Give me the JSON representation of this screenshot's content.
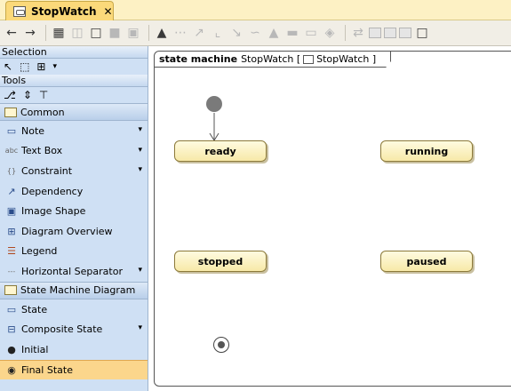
{
  "tab": {
    "title": "StopWatch",
    "close": "✕"
  },
  "palette": {
    "selection_header": "Selection",
    "tools_header": "Tools",
    "groups": [
      {
        "title": "Common",
        "items": [
          {
            "label": "Note",
            "icon": "▭",
            "caret": true
          },
          {
            "label": "Text Box",
            "icon": "abc",
            "caret": true
          },
          {
            "label": "Constraint",
            "icon": "{}",
            "caret": true
          },
          {
            "label": "Dependency",
            "icon": "↗",
            "caret": false
          },
          {
            "label": "Image Shape",
            "icon": "▣",
            "caret": false
          },
          {
            "label": "Diagram Overview",
            "icon": "⊞",
            "caret": false
          },
          {
            "label": "Legend",
            "icon": "☰",
            "caret": false
          },
          {
            "label": "Horizontal Separator",
            "icon": "---",
            "caret": true
          }
        ]
      },
      {
        "title": "State Machine Diagram",
        "items": [
          {
            "label": "State",
            "icon": "▭",
            "caret": false
          },
          {
            "label": "Composite State",
            "icon": "⊟",
            "caret": true
          },
          {
            "label": "Initial",
            "icon": "●",
            "caret": false
          },
          {
            "label": "Final State",
            "icon": "◉",
            "caret": false
          }
        ]
      }
    ]
  },
  "diagram": {
    "frame_keyword": "state machine",
    "frame_name": "StopWatch [",
    "frame_ref": "StopWatch ]",
    "states": {
      "ready": "ready",
      "running": "running",
      "stopped": "stopped",
      "paused": "paused"
    }
  }
}
